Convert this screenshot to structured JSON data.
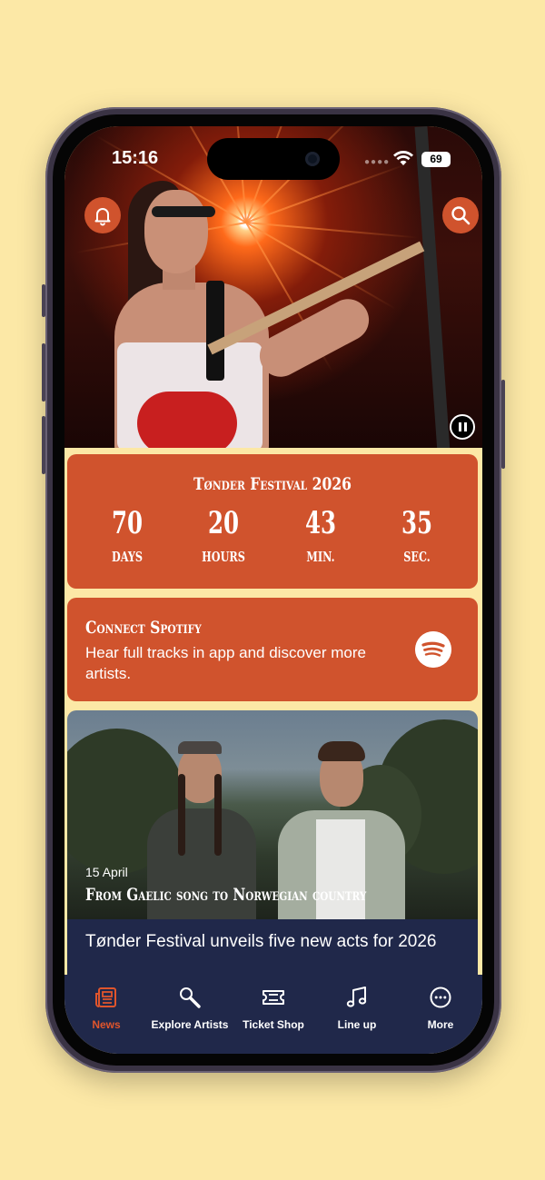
{
  "status_bar": {
    "time": "15:16",
    "battery": "69"
  },
  "hero": {
    "notifications_icon": "bell-icon",
    "search_icon": "search-icon",
    "pause_icon": "pause-icon"
  },
  "countdown": {
    "title": "Tønder Festival 2026",
    "units": [
      {
        "value": "70",
        "label": "DAYS"
      },
      {
        "value": "20",
        "label": "HOURS"
      },
      {
        "value": "43",
        "label": "MIN."
      },
      {
        "value": "35",
        "label": "SEC."
      }
    ]
  },
  "spotify": {
    "title": "Connect Spotify",
    "description": "Hear full tracks in app and discover more artists.",
    "icon": "spotify-icon"
  },
  "news": {
    "date": "15 April",
    "headline": "From Gaelic song to Norwegian country",
    "caption": "Tønder Festival unveils five new acts for 2026"
  },
  "tabs": [
    {
      "label": "News",
      "icon": "newspaper-icon",
      "active": true
    },
    {
      "label": "Explore Artists",
      "icon": "magnifier-icon",
      "active": false
    },
    {
      "label": "Ticket Shop",
      "icon": "ticket-icon",
      "active": false
    },
    {
      "label": "Line up",
      "icon": "music-note-icon",
      "active": false
    },
    {
      "label": "More",
      "icon": "more-icon",
      "active": false
    }
  ],
  "colors": {
    "accent": "#d0532d",
    "background": "#fce8a6",
    "navy": "#20284a"
  }
}
